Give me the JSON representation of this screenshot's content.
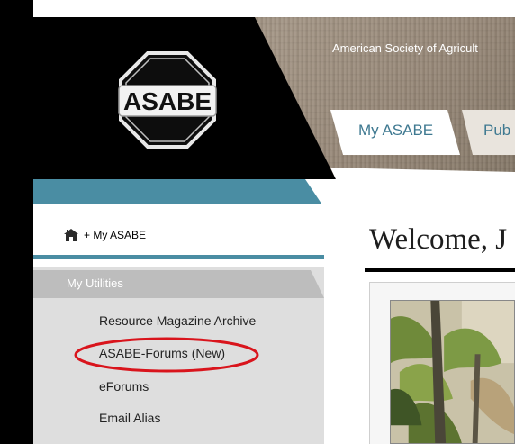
{
  "header": {
    "org_title": "American Society of Agricult",
    "logo_text": "ASABE",
    "tabs": [
      {
        "label": "My ASABE",
        "active": true
      },
      {
        "label": "Pub",
        "active": false
      }
    ]
  },
  "sidebar": {
    "home_label": "+ My ASABE",
    "utilities_title": "My Utilities",
    "items": [
      {
        "label": "Resource Magazine Archive"
      },
      {
        "label": "ASABE-Forums (New)",
        "highlighted": true
      },
      {
        "label": "eForums"
      },
      {
        "label": "Email Alias"
      }
    ]
  },
  "main": {
    "welcome_text": "Welcome, J"
  },
  "colors": {
    "accent_teal": "#4a8da3",
    "tab_text": "#3f7991",
    "highlight_red": "#d9141c",
    "utilities_header_gray": "#bdbdbd"
  },
  "icons": {
    "home": "home-icon",
    "logo": "asabe-logo"
  }
}
